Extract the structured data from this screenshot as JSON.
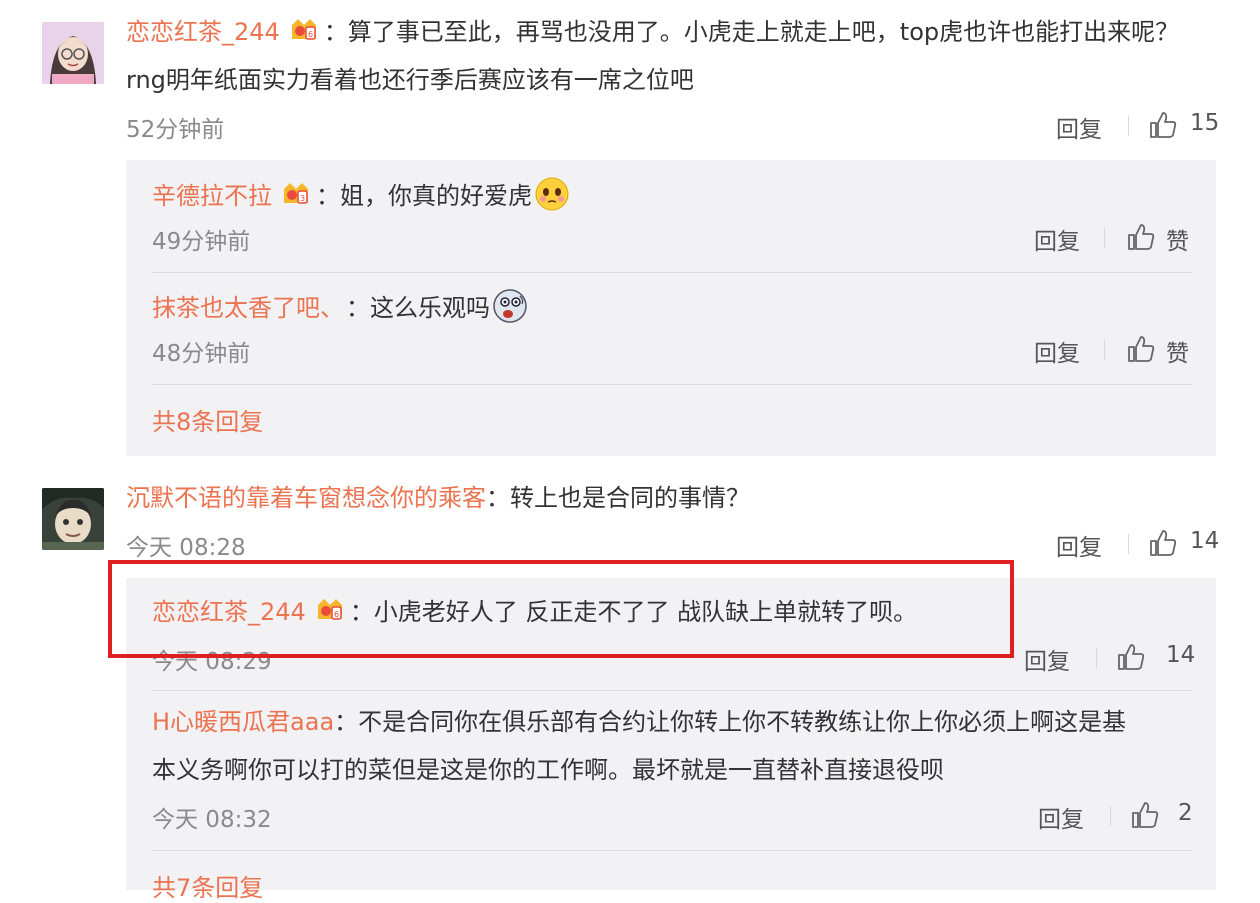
{
  "comments": [
    {
      "user": "恋恋红茶_244",
      "line1": "：算了事已至此，再骂也没用了。小虎走上就走上吧，top虎也许也能打出来呢？",
      "line2": "rng明年纸面实力看着也还行季后赛应该有一席之位吧",
      "time": "52分钟前",
      "reply_label": "回复",
      "likes": "15",
      "replies": [
        {
          "user": "辛德拉不拉",
          "text": "：姐，你真的好爱虎",
          "time": "49分钟前",
          "reply_label": "回复",
          "likes": "赞"
        },
        {
          "user": "抹茶也太香了吧、",
          "text": "：这么乐观吗",
          "time": "48分钟前",
          "reply_label": "回复",
          "likes": "赞"
        }
      ],
      "more_replies": "共8条回复"
    },
    {
      "user": "沉默不语的靠着车窗想念你的乘客",
      "line1": "：转上也是合同的事情？",
      "time": "今天 08:28",
      "reply_label": "回复",
      "likes": "14",
      "replies": [
        {
          "user": "恋恋红茶_244",
          "text": "：小虎老好人了 反正走不了了 战队缺上单就转了呗。",
          "time": "今天 08:29",
          "reply_label": "回复",
          "likes": "14"
        },
        {
          "user": "H心暖西瓜君aaa",
          "text": "：不是合同你在俱乐部有合约让你转上你不转教练让你上你必须上啊这是基",
          "text2": "本义务啊你可以打的菜但是这是你的工作啊。最坏就是一直替补直接退役呗",
          "time": "今天 08:32",
          "reply_label": "回复",
          "likes": "2"
        }
      ],
      "more_replies": "共7条回复"
    }
  ],
  "colors": {
    "username": "#eb7350",
    "highlight": "#e02020",
    "reply_bg": "#f2f2f5"
  }
}
